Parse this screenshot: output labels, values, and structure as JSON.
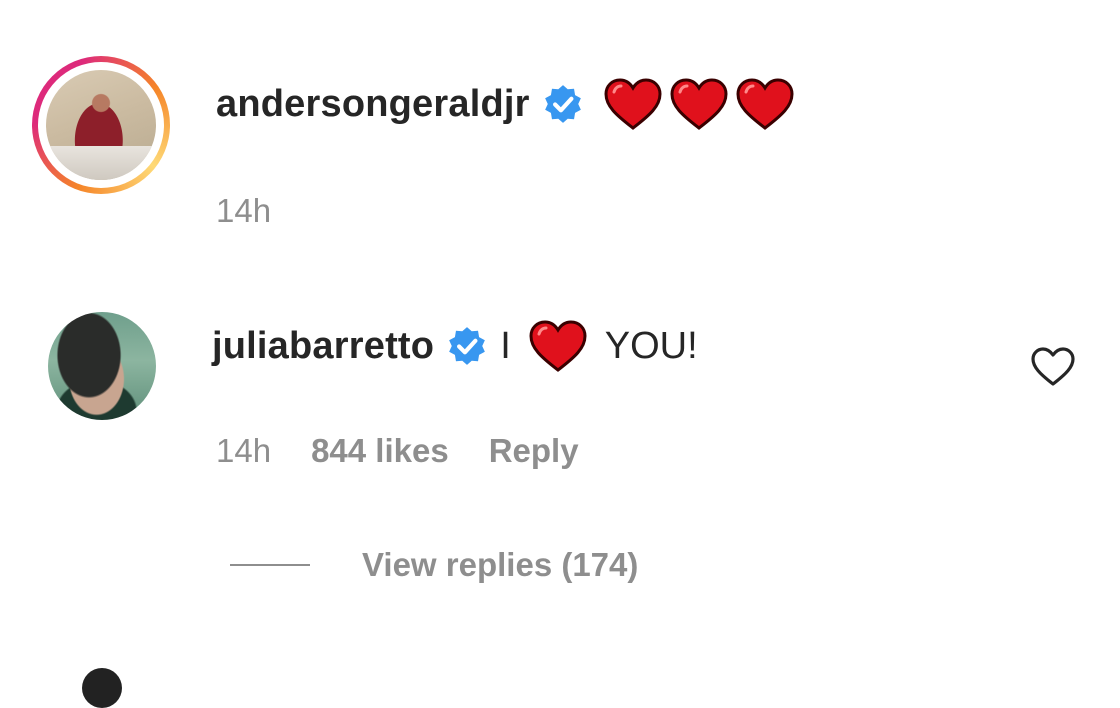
{
  "comments": [
    {
      "username": "andersongeraldjr",
      "verified": true,
      "text_prefix": "",
      "emoji": [
        "heart",
        "heart",
        "heart"
      ],
      "text_suffix": "",
      "time": "14h",
      "has_story_ring": true
    },
    {
      "username": "juliabarretto",
      "verified": true,
      "text_prefix": "I",
      "emoji": [
        "heart"
      ],
      "text_suffix": "YOU!",
      "time": "14h",
      "likes": "844 likes",
      "reply_label": "Reply",
      "view_replies": "View replies (174)",
      "like_icon": "heart-outline-icon"
    }
  ],
  "colors": {
    "text": "#262626",
    "secondary": "#8e8e8e",
    "verified_blue": "#3897f0",
    "heart_red": "#e0111c"
  }
}
